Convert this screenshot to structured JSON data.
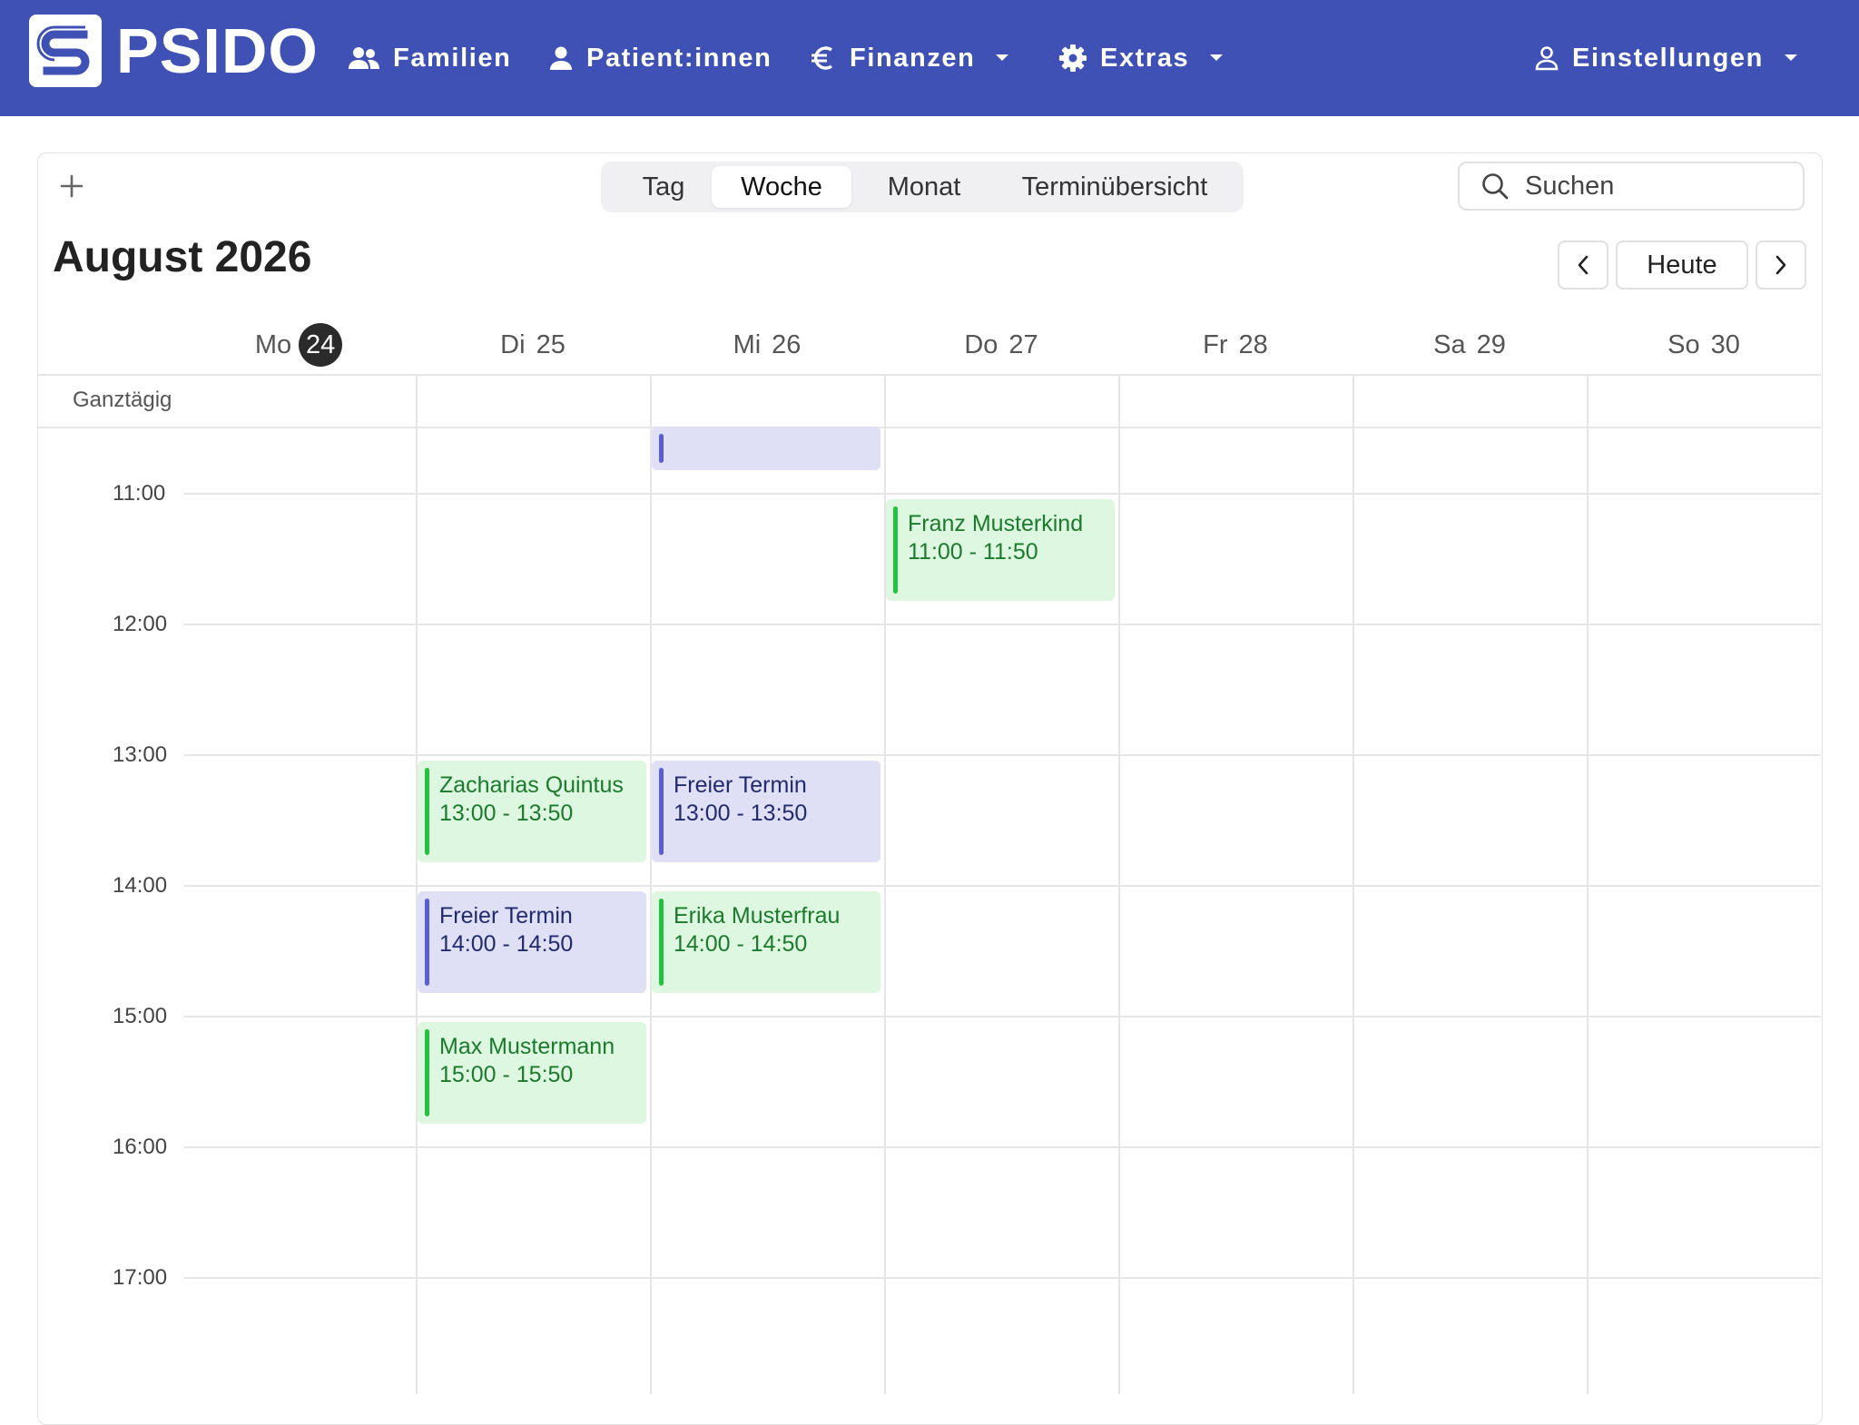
{
  "app": {
    "name": "PSIDO"
  },
  "navbar": {
    "items": [
      {
        "label": "Familien",
        "icon": "people-icon"
      },
      {
        "label": "Patient:innen",
        "icon": "person-icon"
      },
      {
        "label": "Finanzen",
        "icon": "euro-icon",
        "dropdown": true
      },
      {
        "label": "Extras",
        "icon": "gear-icon",
        "dropdown": true
      }
    ],
    "settings": {
      "label": "Einstellungen",
      "icon": "user-outline-icon",
      "dropdown": true
    }
  },
  "toolbar": {
    "view_tabs": [
      "Tag",
      "Woche",
      "Monat",
      "Terminübersicht"
    ],
    "active_view": "Woche",
    "search_placeholder": "Suchen",
    "today_label": "Heute"
  },
  "calendar": {
    "month_title": "August 2026",
    "days": [
      {
        "abbr": "Mo",
        "num": "24",
        "today": true
      },
      {
        "abbr": "Di",
        "num": "25"
      },
      {
        "abbr": "Mi",
        "num": "26"
      },
      {
        "abbr": "Do",
        "num": "27"
      },
      {
        "abbr": "Fr",
        "num": "28"
      },
      {
        "abbr": "Sa",
        "num": "29"
      },
      {
        "abbr": "So",
        "num": "30"
      }
    ],
    "allday_label": "Ganztägig",
    "hours": [
      "11:00",
      "12:00",
      "13:00",
      "14:00",
      "15:00",
      "16:00",
      "17:00"
    ],
    "events": [
      {
        "day": 2,
        "start": "10:00",
        "end": "10:50",
        "title": "",
        "time": "",
        "color": "purple"
      },
      {
        "day": 3,
        "start": "11:00",
        "end": "11:50",
        "title": "Franz Musterkind",
        "time": "11:00 - 11:50",
        "color": "green"
      },
      {
        "day": 1,
        "start": "13:00",
        "end": "13:50",
        "title": "Zacharias Quintus",
        "time": "13:00 - 13:50",
        "color": "green"
      },
      {
        "day": 2,
        "start": "13:00",
        "end": "13:50",
        "title": "Freier Termin",
        "time": "13:00 - 13:50",
        "color": "purple"
      },
      {
        "day": 1,
        "start": "14:00",
        "end": "14:50",
        "title": "Freier Termin",
        "time": "14:00 - 14:50",
        "color": "purple"
      },
      {
        "day": 2,
        "start": "14:00",
        "end": "14:50",
        "title": "Erika Musterfrau",
        "time": "14:00 - 14:50",
        "color": "green"
      },
      {
        "day": 1,
        "start": "15:00",
        "end": "15:50",
        "title": "Max Mustermann",
        "time": "15:00 - 15:50",
        "color": "green"
      }
    ]
  },
  "colors": {
    "navbar": "#3f51b5",
    "event_green_bg": "#ddf7e1",
    "event_green_bar": "#22c13f",
    "event_purple_bg": "#dfdff6",
    "event_purple_bar": "#5b5ed1",
    "today_badge": "#2b2b2b"
  }
}
